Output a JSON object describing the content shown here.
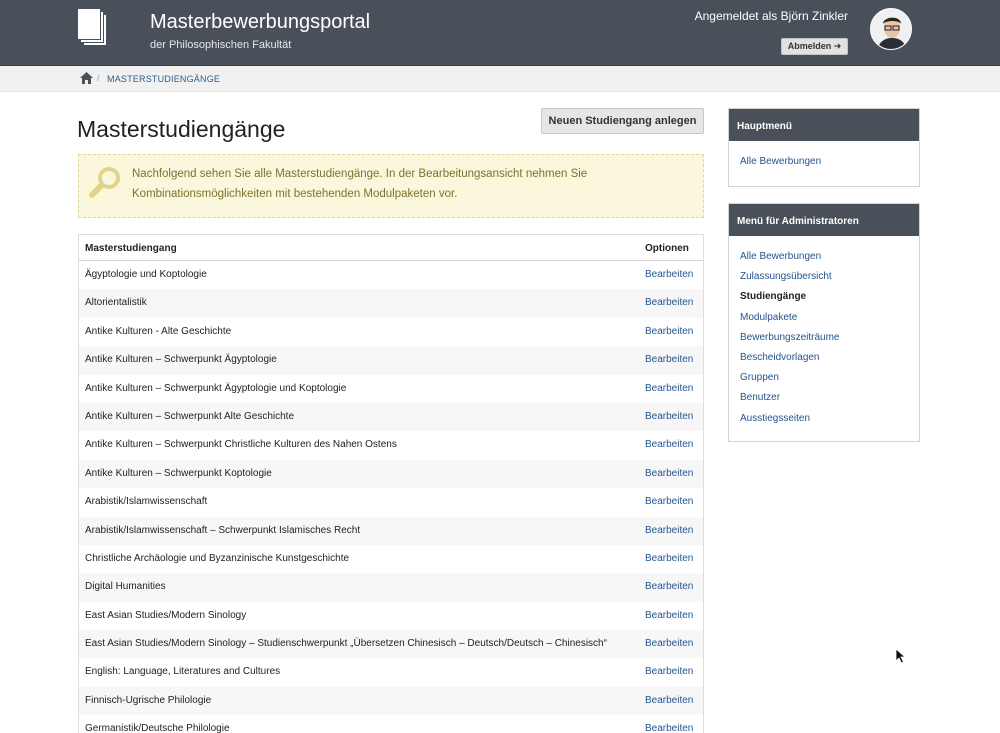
{
  "header": {
    "title": "Masterbewerbungsportal",
    "subtitle": "der Philosophischen Fakultät",
    "logged_in_text": "Angemeldet als Björn Zinkler",
    "logout_label": "Abmelden ➜"
  },
  "breadcrumb": {
    "current": "MASTERSTUDIENGÄNGE"
  },
  "main": {
    "title": "Masterstudiengänge",
    "new_button_label": "Neuen Studiengang anlegen",
    "info_text": "Nachfolgend sehen Sie alle Masterstudiengänge. In der Bearbeitungsansicht nehmen Sie Kombinationsmöglichkeiten mit bestehenden Modulpaketen vor."
  },
  "table": {
    "headers": [
      "Masterstudiengang",
      "Optionen"
    ],
    "rows": [
      {
        "name": "Ägyptologie und Koptologie",
        "action": "Bearbeiten"
      },
      {
        "name": "Altorientalistik",
        "action": "Bearbeiten"
      },
      {
        "name": "Antike Kulturen - Alte Geschichte",
        "action": "Bearbeiten"
      },
      {
        "name": "Antike Kulturen – Schwerpunkt Ägyptologie",
        "action": "Bearbeiten"
      },
      {
        "name": "Antike Kulturen – Schwerpunkt Ägyptologie und Koptologie",
        "action": "Bearbeiten"
      },
      {
        "name": "Antike Kulturen – Schwerpunkt Alte Geschichte",
        "action": "Bearbeiten"
      },
      {
        "name": "Antike Kulturen – Schwerpunkt Christliche Kulturen des Nahen Ostens",
        "action": "Bearbeiten"
      },
      {
        "name": "Antike Kulturen – Schwerpunkt Koptologie",
        "action": "Bearbeiten"
      },
      {
        "name": "Arabistik/Islamwissenschaft",
        "action": "Bearbeiten"
      },
      {
        "name": "Arabistik/Islamwissenschaft – Schwerpunkt Islamisches Recht",
        "action": "Bearbeiten"
      },
      {
        "name": "Christliche Archäologie und Byzanzinische Kunstgeschichte",
        "action": "Bearbeiten"
      },
      {
        "name": "Digital Humanities",
        "action": "Bearbeiten"
      },
      {
        "name": "East Asian Studies/Modern Sinology",
        "action": "Bearbeiten"
      },
      {
        "name": "East Asian Studies/Modern Sinology – Studienschwerpunkt „Übersetzen Chinesisch – Deutsch/Deutsch – Chinesisch“",
        "action": "Bearbeiten"
      },
      {
        "name": "English: Language, Literatures and Cultures",
        "action": "Bearbeiten"
      },
      {
        "name": "Finnisch-Ugrische Philologie",
        "action": "Bearbeiten"
      },
      {
        "name": "Germanistik/Deutsche Philologie",
        "action": "Bearbeiten"
      }
    ]
  },
  "sidebar": {
    "main_menu": {
      "title": "Hauptmenü",
      "items": [
        {
          "label": "Alle Bewerbungen"
        }
      ]
    },
    "admin_menu": {
      "title": "Menü für Administratoren",
      "items": [
        {
          "label": "Alle Bewerbungen",
          "active": false
        },
        {
          "label": "Zulassungsübersicht",
          "active": false
        },
        {
          "label": "Studiengänge",
          "active": true
        },
        {
          "label": "Modulpakete",
          "active": false
        },
        {
          "label": "Bewerbungszeiträume",
          "active": false
        },
        {
          "label": "Bescheidvorlagen",
          "active": false
        },
        {
          "label": "Gruppen",
          "active": false
        },
        {
          "label": "Benutzer",
          "active": false
        },
        {
          "label": "Ausstiegsseiten",
          "active": false
        }
      ]
    }
  },
  "colors": {
    "header_bg": "#4a5059",
    "link": "#24558d",
    "info_bg": "#fbf7dc",
    "info_text": "#7b7230"
  },
  "icons": [
    "documents-logo-icon",
    "home-icon",
    "search-magnifier-icon",
    "user-avatar",
    "mouse-cursor-icon"
  ]
}
